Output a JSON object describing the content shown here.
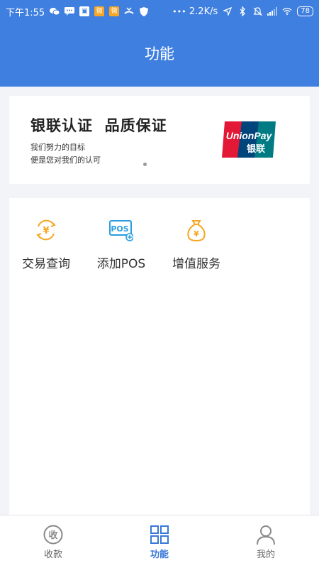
{
  "status_bar": {
    "time": "下午1:55",
    "net_speed": "2.2K/s",
    "battery": "78",
    "icons": [
      "wechat-icon",
      "chat-icon",
      "app-icon",
      "weibo-icon",
      "weibo-icon",
      "missed-call-icon",
      "shield-icon",
      "more-dots-icon",
      "location-icon",
      "bluetooth-icon",
      "mute-icon",
      "signal-icon",
      "wifi-icon",
      "battery-icon"
    ]
  },
  "header": {
    "title": "功能"
  },
  "banner": {
    "headline": "银联认证  品质保证",
    "sub_line1": "我们努力的目标",
    "sub_line2": "便是您对我们的认可",
    "logo_text": "UnionPay",
    "logo_cn": "银联",
    "logo_colors": [
      "#e21836",
      "#00447c",
      "#007b84"
    ]
  },
  "functions": [
    {
      "label": "交易查询",
      "icon": "yuan-exchange-icon"
    },
    {
      "label": "添加POS",
      "icon": "pos-add-icon"
    },
    {
      "label": "增值服务",
      "icon": "money-bag-icon"
    }
  ],
  "tabbar": {
    "tabs": [
      {
        "label": "收款",
        "icon": "collect-money-icon",
        "active": false
      },
      {
        "label": "功能",
        "icon": "grid-icon",
        "active": true
      },
      {
        "label": "我的",
        "icon": "user-icon",
        "active": false
      }
    ]
  },
  "colors": {
    "primary": "#3f7fdf",
    "accent_orange": "#f6a623",
    "pos_blue": "#2a9ee0",
    "tab_active": "#3a78d8"
  }
}
